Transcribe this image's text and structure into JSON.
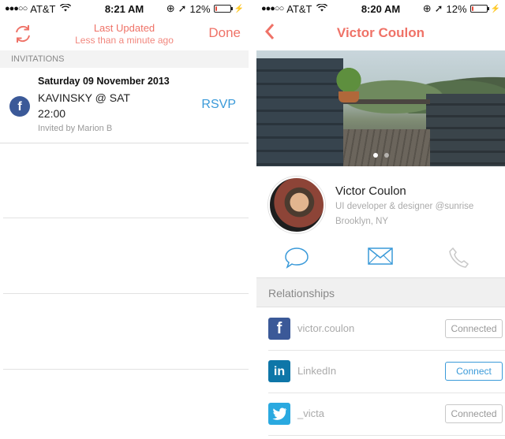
{
  "status_left": {
    "signal": "●●●○○",
    "carrier": "AT&T",
    "wifi": "wifi-icon",
    "time": "8:21 AM",
    "battery": "12%",
    "battery_level": 0.12
  },
  "status_right": {
    "signal": "●●●○○",
    "carrier": "AT&T",
    "wifi": "wifi-icon",
    "time": "8:20 AM",
    "battery": "12%",
    "battery_level": 0.12
  },
  "invitations_screen": {
    "last_updated_title": "Last Updated",
    "last_updated_sub": "Less than a minute ago",
    "done_label": "Done",
    "section_label": "INVITATIONS",
    "event": {
      "date": "Saturday 09 November 2013",
      "name": "KAVINSKY @ SAT",
      "time": "22:00",
      "invited_by": "Invited by Marion B",
      "action": "RSVP",
      "source_icon": "f"
    }
  },
  "profile_screen": {
    "back_icon": "‹",
    "title": "Victor Coulon",
    "name": "Victor Coulon",
    "role": "UI developer & designer @sunrise",
    "location": "Brooklyn, NY",
    "relationships_label": "Relationships",
    "relationships": [
      {
        "network": "facebook",
        "icon": "f",
        "color": "#3b5998",
        "label": "victor.coulon",
        "button": "Connected",
        "active": false
      },
      {
        "network": "linkedin",
        "icon": "in",
        "color": "#0e76a8",
        "label": "LinkedIn",
        "button": "Connect",
        "active": true
      },
      {
        "network": "twitter",
        "icon": "🐦",
        "color": "#2aa9e0",
        "label": "_victa",
        "button": "Connected",
        "active": false
      }
    ]
  },
  "colors": {
    "accent": "#ef7267",
    "link": "#3a9ad9"
  }
}
